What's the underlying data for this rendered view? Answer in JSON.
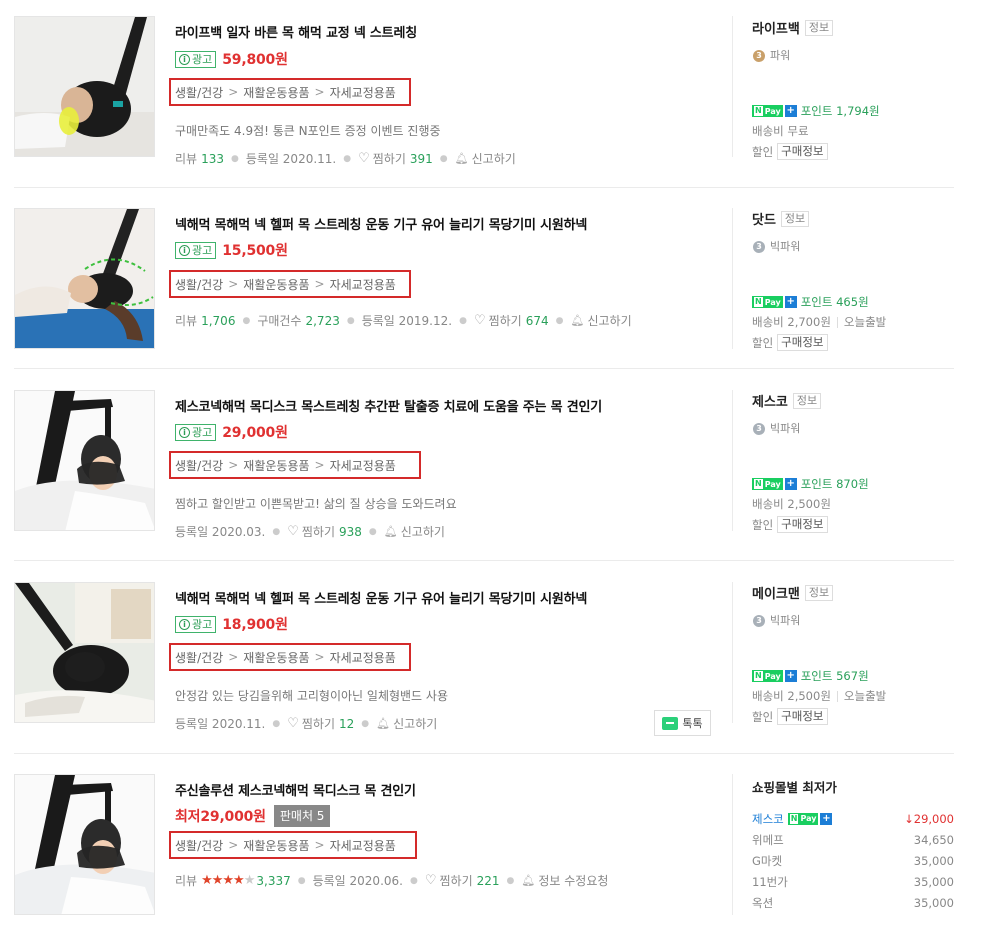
{
  "products": [
    {
      "title": "라이프백 일자 바른 목 해먹 교정 넥 스트레칭",
      "ad_label": "광고",
      "price": "59,800원",
      "category": [
        "생활/건강",
        "재활운동용품",
        "자세교정용품"
      ],
      "description": "구매만족도 4.9점! 통큰 N포인트 증정 이벤트 진행중",
      "meta": {
        "review_label": "리뷰",
        "review_count": "133",
        "reg_label": "등록일 2020.11.",
        "wish_label": "찜하기",
        "wish_count": "391",
        "report_label": "신고하기"
      },
      "mall": {
        "name": "라이프백",
        "info_label": "정보",
        "grade": "파워",
        "point": "포인트 1,794원",
        "shipping": "배송비 무료",
        "discount_label": "할인",
        "purchase_info": "구매정보"
      }
    },
    {
      "title": "넥해먹 목해먹 넥 헬퍼 목 스트레칭 운동 기구 유어 늘리기 목당기미 시원하넥",
      "ad_label": "광고",
      "price": "15,500원",
      "category": [
        "생활/건강",
        "재활운동용품",
        "자세교정용품"
      ],
      "meta": {
        "review_label": "리뷰",
        "review_count": "1,706",
        "buy_label": "구매건수",
        "buy_count": "2,723",
        "reg_label": "등록일 2019.12.",
        "wish_label": "찜하기",
        "wish_count": "674",
        "report_label": "신고하기"
      },
      "mall": {
        "name": "닷드",
        "info_label": "정보",
        "grade": "빅파워",
        "point": "포인트 465원",
        "shipping": "배송비 2,700원",
        "today": "오늘출발",
        "discount_label": "할인",
        "purchase_info": "구매정보"
      }
    },
    {
      "title": "제스코넥해먹 목디스크 목스트레칭 추간판 탈출증 치료에 도움을 주는 목 견인기",
      "ad_label": "광고",
      "price": "29,000원",
      "category": [
        "생활/건강",
        "재활운동용품",
        "자세교정용품"
      ],
      "description": "찜하고 할인받고 이쁜목받고! 삶의 질 상승을 도와드려요",
      "meta": {
        "reg_label": "등록일 2020.03.",
        "wish_label": "찜하기",
        "wish_count": "938",
        "report_label": "신고하기"
      },
      "mall": {
        "name": "제스코",
        "info_label": "정보",
        "grade": "빅파워",
        "point": "포인트 870원",
        "shipping": "배송비 2,500원",
        "discount_label": "할인",
        "purchase_info": "구매정보"
      }
    },
    {
      "title": "넥해먹 목해먹 넥 헬퍼 목 스트레칭 운동 기구 유어 늘리기 목당기미 시원하넥",
      "ad_label": "광고",
      "price": "18,900원",
      "category": [
        "생활/건강",
        "재활운동용품",
        "자세교정용품"
      ],
      "description": "안정감 있는 당김을위해 고리형이아닌 일체형밴드 사용",
      "meta": {
        "reg_label": "등록일 2020.11.",
        "wish_label": "찜하기",
        "wish_count": "12",
        "report_label": "신고하기"
      },
      "talk_label": "톡톡",
      "mall": {
        "name": "메이크맨",
        "info_label": "정보",
        "grade": "빅파워",
        "point": "포인트 567원",
        "shipping": "배송비 2,500원",
        "today": "오늘출발",
        "discount_label": "할인",
        "purchase_info": "구매정보"
      }
    },
    {
      "title": "주신솔루션 제스코넥해먹 목디스크 목 견인기",
      "price": "최저29,000원",
      "sellers": "판매처 5",
      "category": [
        "생활/건강",
        "재활운동용품",
        "자세교정용품"
      ],
      "meta": {
        "review_label": "리뷰",
        "rating": 4.5,
        "review_count": "3,337",
        "reg_label": "등록일 2020.06.",
        "wish_label": "찜하기",
        "wish_count": "221",
        "report_label": "정보 수정요청"
      },
      "lowest": {
        "title": "쇼핑몰별 최저가",
        "rows": [
          {
            "shop": "제스코",
            "price": "29,000"
          },
          {
            "shop": "위메프",
            "price": "34,650"
          },
          {
            "shop": "G마켓",
            "price": "35,000"
          },
          {
            "shop": "11번가",
            "price": "35,000"
          },
          {
            "shop": "옥션",
            "price": "35,000"
          }
        ]
      }
    }
  ],
  "npay_label": "Pay",
  "colors": {
    "accent_green": "#2aa05a",
    "price_red": "#e03131",
    "highlight_red": "#d42a2a",
    "naver_green": "#19ce60"
  }
}
